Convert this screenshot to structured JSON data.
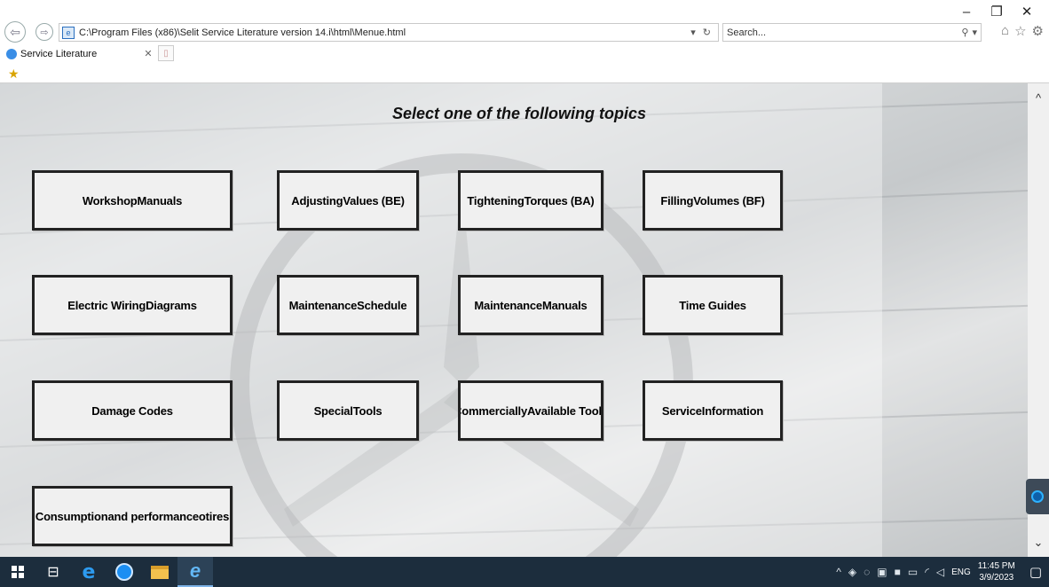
{
  "window": {
    "minimize": "–",
    "restore": "❐",
    "close": "✕"
  },
  "browser": {
    "address": "C:\\Program Files (x86)\\Selit Service Literature version 14.i\\html\\Menue.html",
    "search_placeholder": "Search...",
    "tab_title": "Service Literature"
  },
  "page": {
    "heading": "Select one of the following topics",
    "topics": [
      {
        "label": "WorkshopManuals"
      },
      {
        "label": "AdjustingValues (BE)"
      },
      {
        "label": "TighteningTorques (BA)"
      },
      {
        "label": "FillingVolumes (BF)"
      },
      {
        "label": "Electric WiringDiagrams"
      },
      {
        "label": "MaintenanceSchedule"
      },
      {
        "label": "MaintenanceManuals"
      },
      {
        "label": "Time Guides"
      },
      {
        "label": "Damage Codes"
      },
      {
        "label": "SpecialTools"
      },
      {
        "label": "CommerciallyAvailable Tools"
      },
      {
        "label": "ServiceInformation"
      },
      {
        "label": "Consumptionand performanceotires"
      }
    ]
  },
  "taskbar": {
    "language": "ENG",
    "time": "11:45 PM",
    "date": "3/9/2023"
  }
}
